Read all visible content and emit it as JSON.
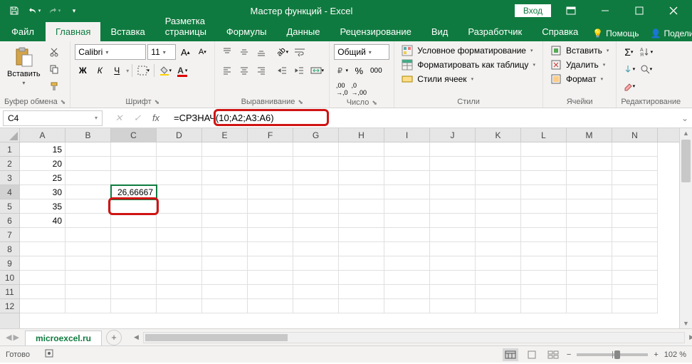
{
  "title": "Мастер функций  -  Excel",
  "login": "Вход",
  "tabs": {
    "file": "Файл",
    "items": [
      "Главная",
      "Вставка",
      "Разметка страницы",
      "Формулы",
      "Данные",
      "Рецензирование",
      "Вид",
      "Разработчик",
      "Справка"
    ]
  },
  "tell_me": "Помощь",
  "share": "Поделиться",
  "ribbon": {
    "clipboard": {
      "paste": "Вставить",
      "label": "Буфер обмена"
    },
    "font": {
      "name": "Calibri",
      "size": "11",
      "label": "Шрифт",
      "bold": "Ж",
      "italic": "К",
      "underline": "Ч"
    },
    "align": {
      "label": "Выравнивание"
    },
    "number": {
      "format": "Общий",
      "label": "Число"
    },
    "styles": {
      "cond": "Условное форматирование",
      "table": "Форматировать как таблицу",
      "cell": "Стили ячеек",
      "label": "Стили"
    },
    "cells": {
      "insert": "Вставить",
      "delete": "Удалить",
      "format": "Формат",
      "label": "Ячейки"
    },
    "editing": {
      "label": "Редактирование"
    }
  },
  "namebox": "C4",
  "formula": "=СРЗНАЧ(10;A2;A3:A6)",
  "columns": [
    "A",
    "B",
    "C",
    "D",
    "E",
    "F",
    "G",
    "H",
    "I",
    "J",
    "K",
    "L",
    "M",
    "N"
  ],
  "rows": [
    "1",
    "2",
    "3",
    "4",
    "5",
    "6",
    "7",
    "8",
    "9",
    "10",
    "11",
    "12"
  ],
  "grid": [
    [
      "15",
      "",
      "",
      "",
      "",
      "",
      "",
      "",
      "",
      "",
      "",
      "",
      "",
      ""
    ],
    [
      "20",
      "",
      "",
      "",
      "",
      "",
      "",
      "",
      "",
      "",
      "",
      "",
      "",
      ""
    ],
    [
      "25",
      "",
      "",
      "",
      "",
      "",
      "",
      "",
      "",
      "",
      "",
      "",
      "",
      ""
    ],
    [
      "30",
      "",
      "26,66667",
      "",
      "",
      "",
      "",
      "",
      "",
      "",
      "",
      "",
      "",
      ""
    ],
    [
      "35",
      "",
      "",
      "",
      "",
      "",
      "",
      "",
      "",
      "",
      "",
      "",
      "",
      ""
    ],
    [
      "40",
      "",
      "",
      "",
      "",
      "",
      "",
      "",
      "",
      "",
      "",
      "",
      "",
      ""
    ],
    [
      "",
      "",
      "",
      "",
      "",
      "",
      "",
      "",
      "",
      "",
      "",
      "",
      "",
      ""
    ],
    [
      "",
      "",
      "",
      "",
      "",
      "",
      "",
      "",
      "",
      "",
      "",
      "",
      "",
      ""
    ],
    [
      "",
      "",
      "",
      "",
      "",
      "",
      "",
      "",
      "",
      "",
      "",
      "",
      "",
      ""
    ],
    [
      "",
      "",
      "",
      "",
      "",
      "",
      "",
      "",
      "",
      "",
      "",
      "",
      "",
      ""
    ],
    [
      "",
      "",
      "",
      "",
      "",
      "",
      "",
      "",
      "",
      "",
      "",
      "",
      "",
      ""
    ],
    [
      "",
      "",
      "",
      "",
      "",
      "",
      "",
      "",
      "",
      "",
      "",
      "",
      "",
      ""
    ]
  ],
  "active": {
    "row": 3,
    "col": 2
  },
  "sheet": "microexcel.ru",
  "status": "Готово",
  "zoom": "102 %"
}
